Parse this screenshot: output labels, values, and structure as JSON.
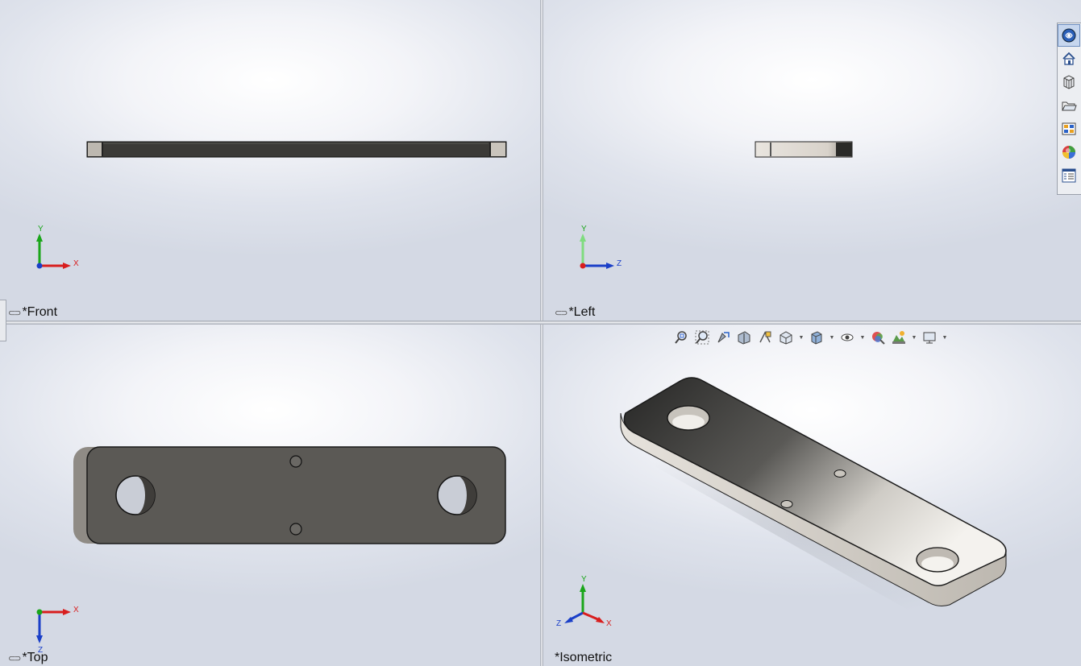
{
  "views": {
    "front": {
      "label": "*Front",
      "axes": {
        "a": "Y",
        "b": "X"
      }
    },
    "left": {
      "label": "*Left",
      "axes": {
        "a": "Y",
        "b": "Z"
      }
    },
    "top": {
      "label": "*Top",
      "axes": {
        "a": "Z",
        "b": "X"
      }
    },
    "isometric": {
      "label": "*Isometric",
      "axes": {
        "y": "Y",
        "z": "Z",
        "x": "X"
      }
    }
  },
  "taskpane": {
    "items": [
      {
        "name": "solidworks-resources-icon",
        "active": true
      },
      {
        "name": "home-icon",
        "active": false
      },
      {
        "name": "design-library-icon",
        "active": false
      },
      {
        "name": "file-explorer-icon",
        "active": false
      },
      {
        "name": "view-palette-icon",
        "active": false
      },
      {
        "name": "appearances-icon",
        "active": false
      },
      {
        "name": "custom-properties-icon",
        "active": false
      }
    ]
  },
  "heads_up_toolbar": {
    "items": [
      "zoom-to-fit-icon",
      "zoom-to-area-icon",
      "previous-view-icon",
      "section-view-icon",
      "dynamic-annotation-icon",
      "view-orientation-icon",
      "display-style-icon",
      "hide-show-items-icon",
      "edit-appearance-icon",
      "apply-scene-icon",
      "view-settings-icon"
    ]
  },
  "colors": {
    "axis_x": "#d81e1e",
    "axis_y": "#1aa61a",
    "axis_z": "#1a3fc8",
    "part_dark": "#3a3936",
    "part_edge": "#1a1a1a"
  }
}
